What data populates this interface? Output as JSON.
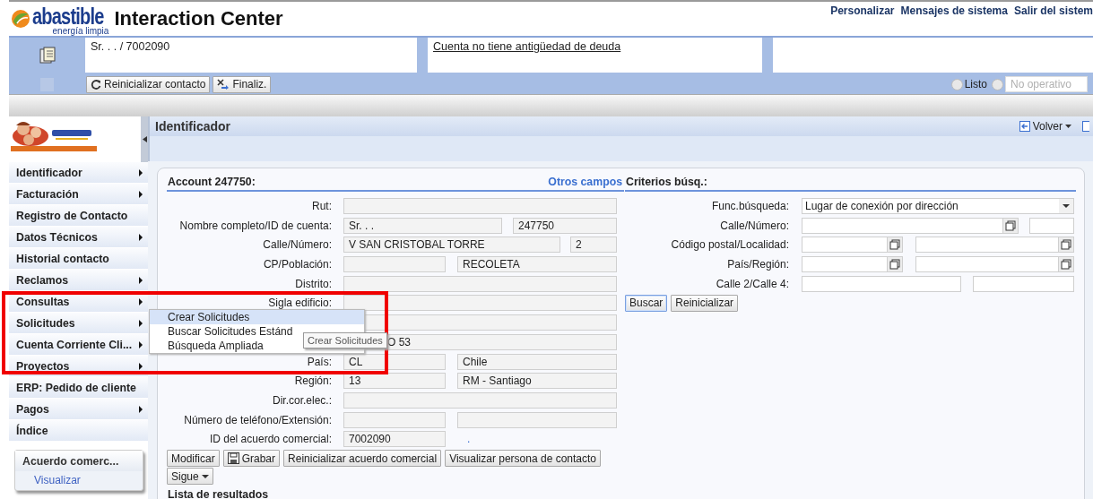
{
  "header": {
    "brand": "abastible",
    "tagline": "energía limpia",
    "title": "Interaction Center",
    "links": [
      "Personalizar",
      "Mensajes de sistema",
      "Salir del sistem"
    ]
  },
  "contact": {
    "info": "Sr. . . / 7002090",
    "alert": "Cuenta no tiene antigüedad de deuda",
    "buttons": [
      "Reinicializar contacto",
      "Finaliz."
    ],
    "status_radios": [
      {
        "label": "Listo",
        "selected": false
      },
      {
        "selected": false
      }
    ],
    "status_field": {
      "placeholder": "No operativo"
    }
  },
  "sidebar": {
    "items": [
      {
        "label": "Identificador",
        "submenu": true
      },
      {
        "label": "Facturación",
        "submenu": true
      },
      {
        "label": "Registro de Contacto",
        "submenu": false
      },
      {
        "label": "Datos Técnicos",
        "submenu": true
      },
      {
        "label": "Historial contacto",
        "submenu": false
      },
      {
        "label": "Reclamos",
        "submenu": true
      },
      {
        "label": "Consultas",
        "submenu": true
      },
      {
        "label": "Solicitudes",
        "submenu": true
      },
      {
        "label": "Cuenta Corriente Cli...",
        "submenu": true
      },
      {
        "label": "Proyectos",
        "submenu": true
      },
      {
        "label": "ERP: Pedido de cliente",
        "submenu": false
      },
      {
        "label": "Pagos",
        "submenu": true
      },
      {
        "label": "Índice",
        "submenu": false
      }
    ],
    "panel": {
      "title": "Acuerdo comerc...",
      "link": "Visualizar"
    }
  },
  "page": {
    "title": "Identificador",
    "back": "Volver"
  },
  "account": {
    "title": "Account 247750:",
    "link": "Otros campos",
    "rows": [
      {
        "label": "Rut:",
        "kind": "full",
        "fields": [
          {
            "kind": "text"
          }
        ]
      },
      {
        "label": "Nombre completo/ID de cuenta:",
        "kind": "name",
        "fields": [
          {
            "kind": "text",
            "value": "Sr. . ."
          },
          {
            "kind": "text",
            "value": "247750"
          }
        ]
      },
      {
        "label": "Calle/Número:",
        "kind": "street",
        "fields": [
          {
            "kind": "text",
            "value": "V SAN CRISTOBAL TORRE"
          },
          {
            "kind": "text",
            "value": "2"
          }
        ]
      },
      {
        "label": "CP/Población:",
        "kind": "pair",
        "fields": [
          {
            "kind": "text"
          },
          {
            "kind": "text",
            "value": "RECOLETA"
          }
        ]
      },
      {
        "label": "Distrito:",
        "kind": "full",
        "fields": [
          {
            "kind": "text"
          }
        ]
      },
      {
        "label": "Sigla edificio:",
        "kind": "full",
        "fields": [
          {
            "kind": "text"
          }
        ]
      },
      {
        "kind": "full",
        "fields": [
          {
            "kind": "text"
          }
        ]
      },
      {
        "kind": "full",
        "covered": true,
        "fields": [
          {
            "kind": "text",
            "value": "O 53"
          }
        ]
      },
      {
        "label": "País:",
        "kind": "pair",
        "fields": [
          {
            "kind": "text",
            "value": "CL"
          },
          {
            "kind": "text",
            "value": "Chile"
          }
        ]
      },
      {
        "label": "Región:",
        "kind": "pair",
        "fields": [
          {
            "kind": "text",
            "value": "13"
          },
          {
            "kind": "text",
            "value": "RM - Santiago"
          }
        ]
      },
      {
        "label": "Dir.cor.elec.:",
        "kind": "full",
        "fields": [
          {
            "kind": "text"
          }
        ]
      },
      {
        "label": "Número de teléfono/Extensión:",
        "kind": "pair",
        "fields": [
          {
            "kind": "text"
          },
          {
            "kind": "text"
          }
        ]
      },
      {
        "label": "ID del acuerdo comercial:",
        "kind": "short",
        "fields": [
          {
            "kind": "text",
            "value": "7002090"
          }
        ],
        "suffix": "."
      }
    ],
    "buttons": [
      "Modificar",
      "Grabar",
      "Reinicializar acuerdo comercial",
      "Visualizar persona de contacto"
    ],
    "more": "Sigue",
    "results_title": "Lista de resultados"
  },
  "search": {
    "title": "Criterios búsq.:",
    "rows": [
      {
        "label": "Func.búsqueda:",
        "kind": "select",
        "fields": [
          {
            "kind": "select",
            "value": "Lugar de conexión por dirección"
          }
        ]
      },
      {
        "label": "Calle/Número:",
        "kind": "street",
        "fields": [
          {
            "kind": "lookup"
          },
          {
            "kind": "text"
          }
        ]
      },
      {
        "label": "Código postal/Localidad:",
        "kind": "pair",
        "fields": [
          {
            "kind": "lookup"
          },
          {
            "kind": "lookup"
          }
        ]
      },
      {
        "label": "País/Región:",
        "kind": "pair",
        "fields": [
          {
            "kind": "lookup"
          },
          {
            "kind": "lookup"
          }
        ]
      },
      {
        "label": "Calle 2/Calle 4:",
        "kind": "wide",
        "fields": [
          {
            "kind": "text"
          },
          {
            "kind": "text"
          }
        ]
      }
    ],
    "buttons": [
      {
        "label": "Buscar",
        "focused": true
      },
      {
        "label": "Reinicializar",
        "focused": false
      }
    ]
  },
  "context_menu": {
    "items": [
      {
        "label": "Crear Solicitudes",
        "selected": true
      },
      {
        "label": "Buscar Solicitudes Estánd",
        "selected": false
      },
      {
        "label": "Búsqueda Ampliada",
        "selected": false
      }
    ],
    "tooltip": "Crear Solicitudes"
  }
}
